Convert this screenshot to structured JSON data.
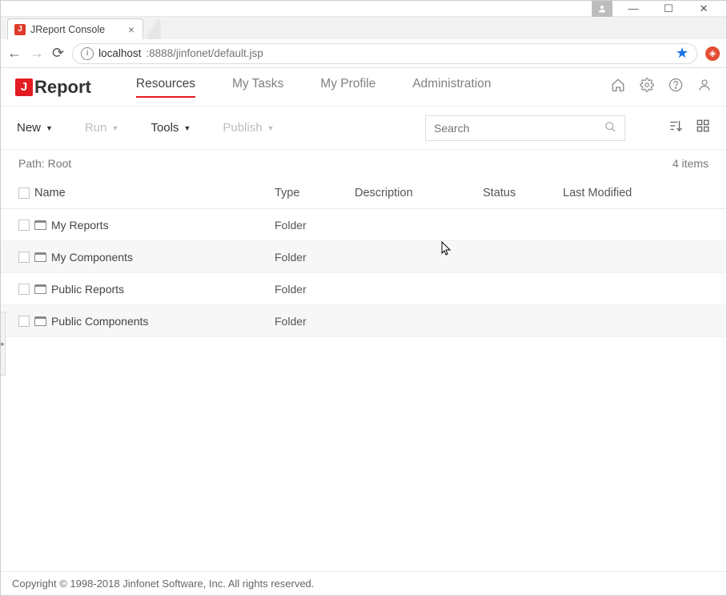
{
  "window": {
    "tab_title": "JReport Console",
    "url_prefix": "localhost",
    "url_rest": ":8888/jinfonet/default.jsp"
  },
  "logo": {
    "j": "J",
    "rest": "Report"
  },
  "nav": {
    "resources": "Resources",
    "mytasks": "My Tasks",
    "myprofile": "My Profile",
    "admin": "Administration"
  },
  "toolbar": {
    "new": "New",
    "run": "Run",
    "tools": "Tools",
    "publish": "Publish"
  },
  "search": {
    "placeholder": "Search"
  },
  "path": {
    "label": "Path: Root",
    "count": "4 items"
  },
  "columns": {
    "name": "Name",
    "type": "Type",
    "description": "Description",
    "status": "Status",
    "modified": "Last Modified"
  },
  "rows": [
    {
      "name": "My Reports",
      "type": "Folder"
    },
    {
      "name": "My Components",
      "type": "Folder"
    },
    {
      "name": "Public Reports",
      "type": "Folder"
    },
    {
      "name": "Public Components",
      "type": "Folder"
    }
  ],
  "footer": "Copyright © 1998-2018 Jinfonet Software, Inc. All rights reserved."
}
